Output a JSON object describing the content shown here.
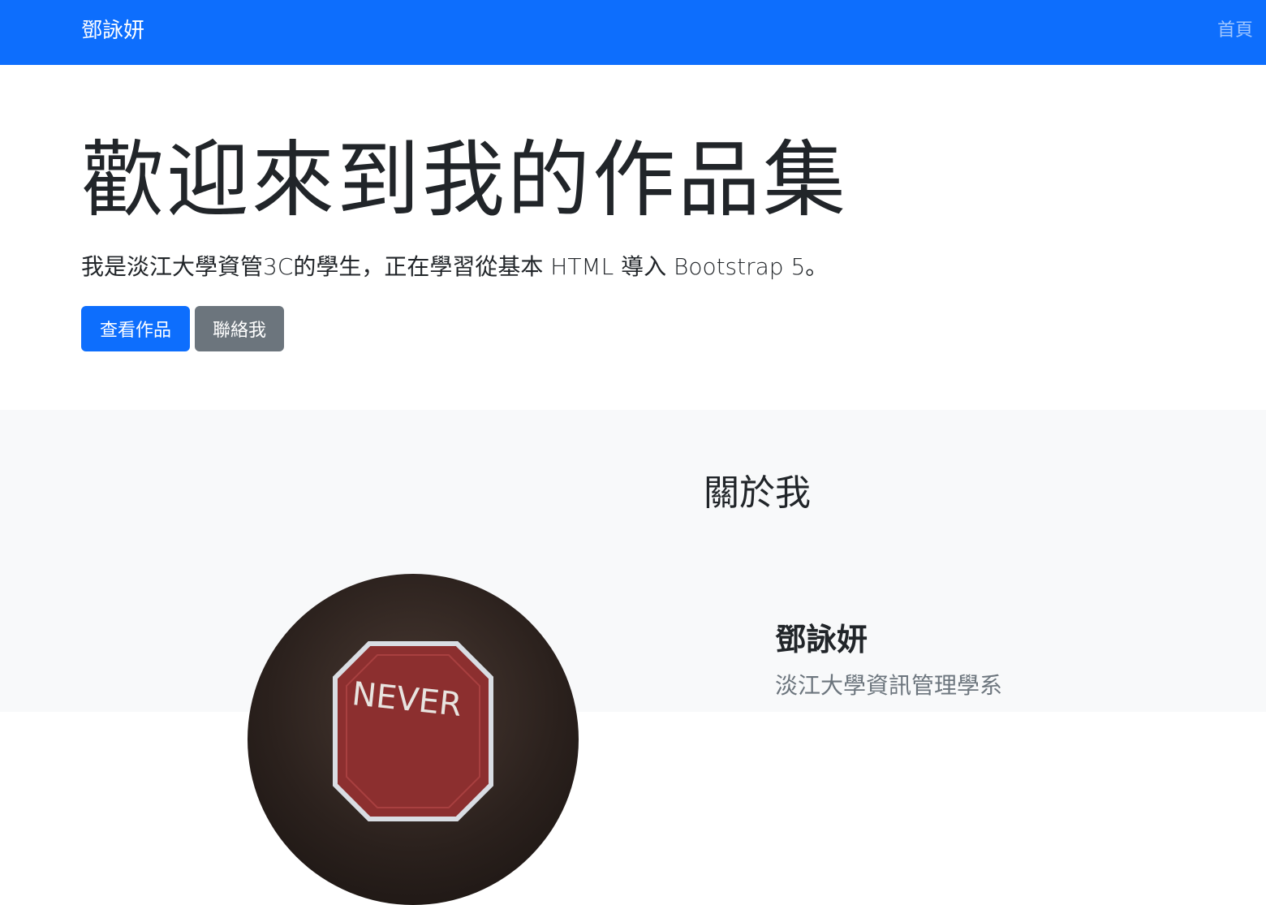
{
  "navbar": {
    "brand": "鄧詠妍",
    "links": [
      {
        "label": "首頁"
      }
    ],
    "color": "#0d6efd"
  },
  "hero": {
    "title": "歡迎來到我的作品集",
    "lead": "我是淡江大學資管3C的學生，正在學習從基本 HTML 導入 Bootstrap 5。",
    "buttons": {
      "primary_label": "查看作品",
      "secondary_label": "聯絡我"
    }
  },
  "about": {
    "heading": "關於我",
    "name": "鄧詠妍",
    "department": "淡江大學資訊管理學系",
    "avatar_sign_text": "NEVER"
  },
  "colors": {
    "primary": "#0d6efd",
    "secondary": "#6c757d",
    "light_bg": "#f8f9fa"
  }
}
